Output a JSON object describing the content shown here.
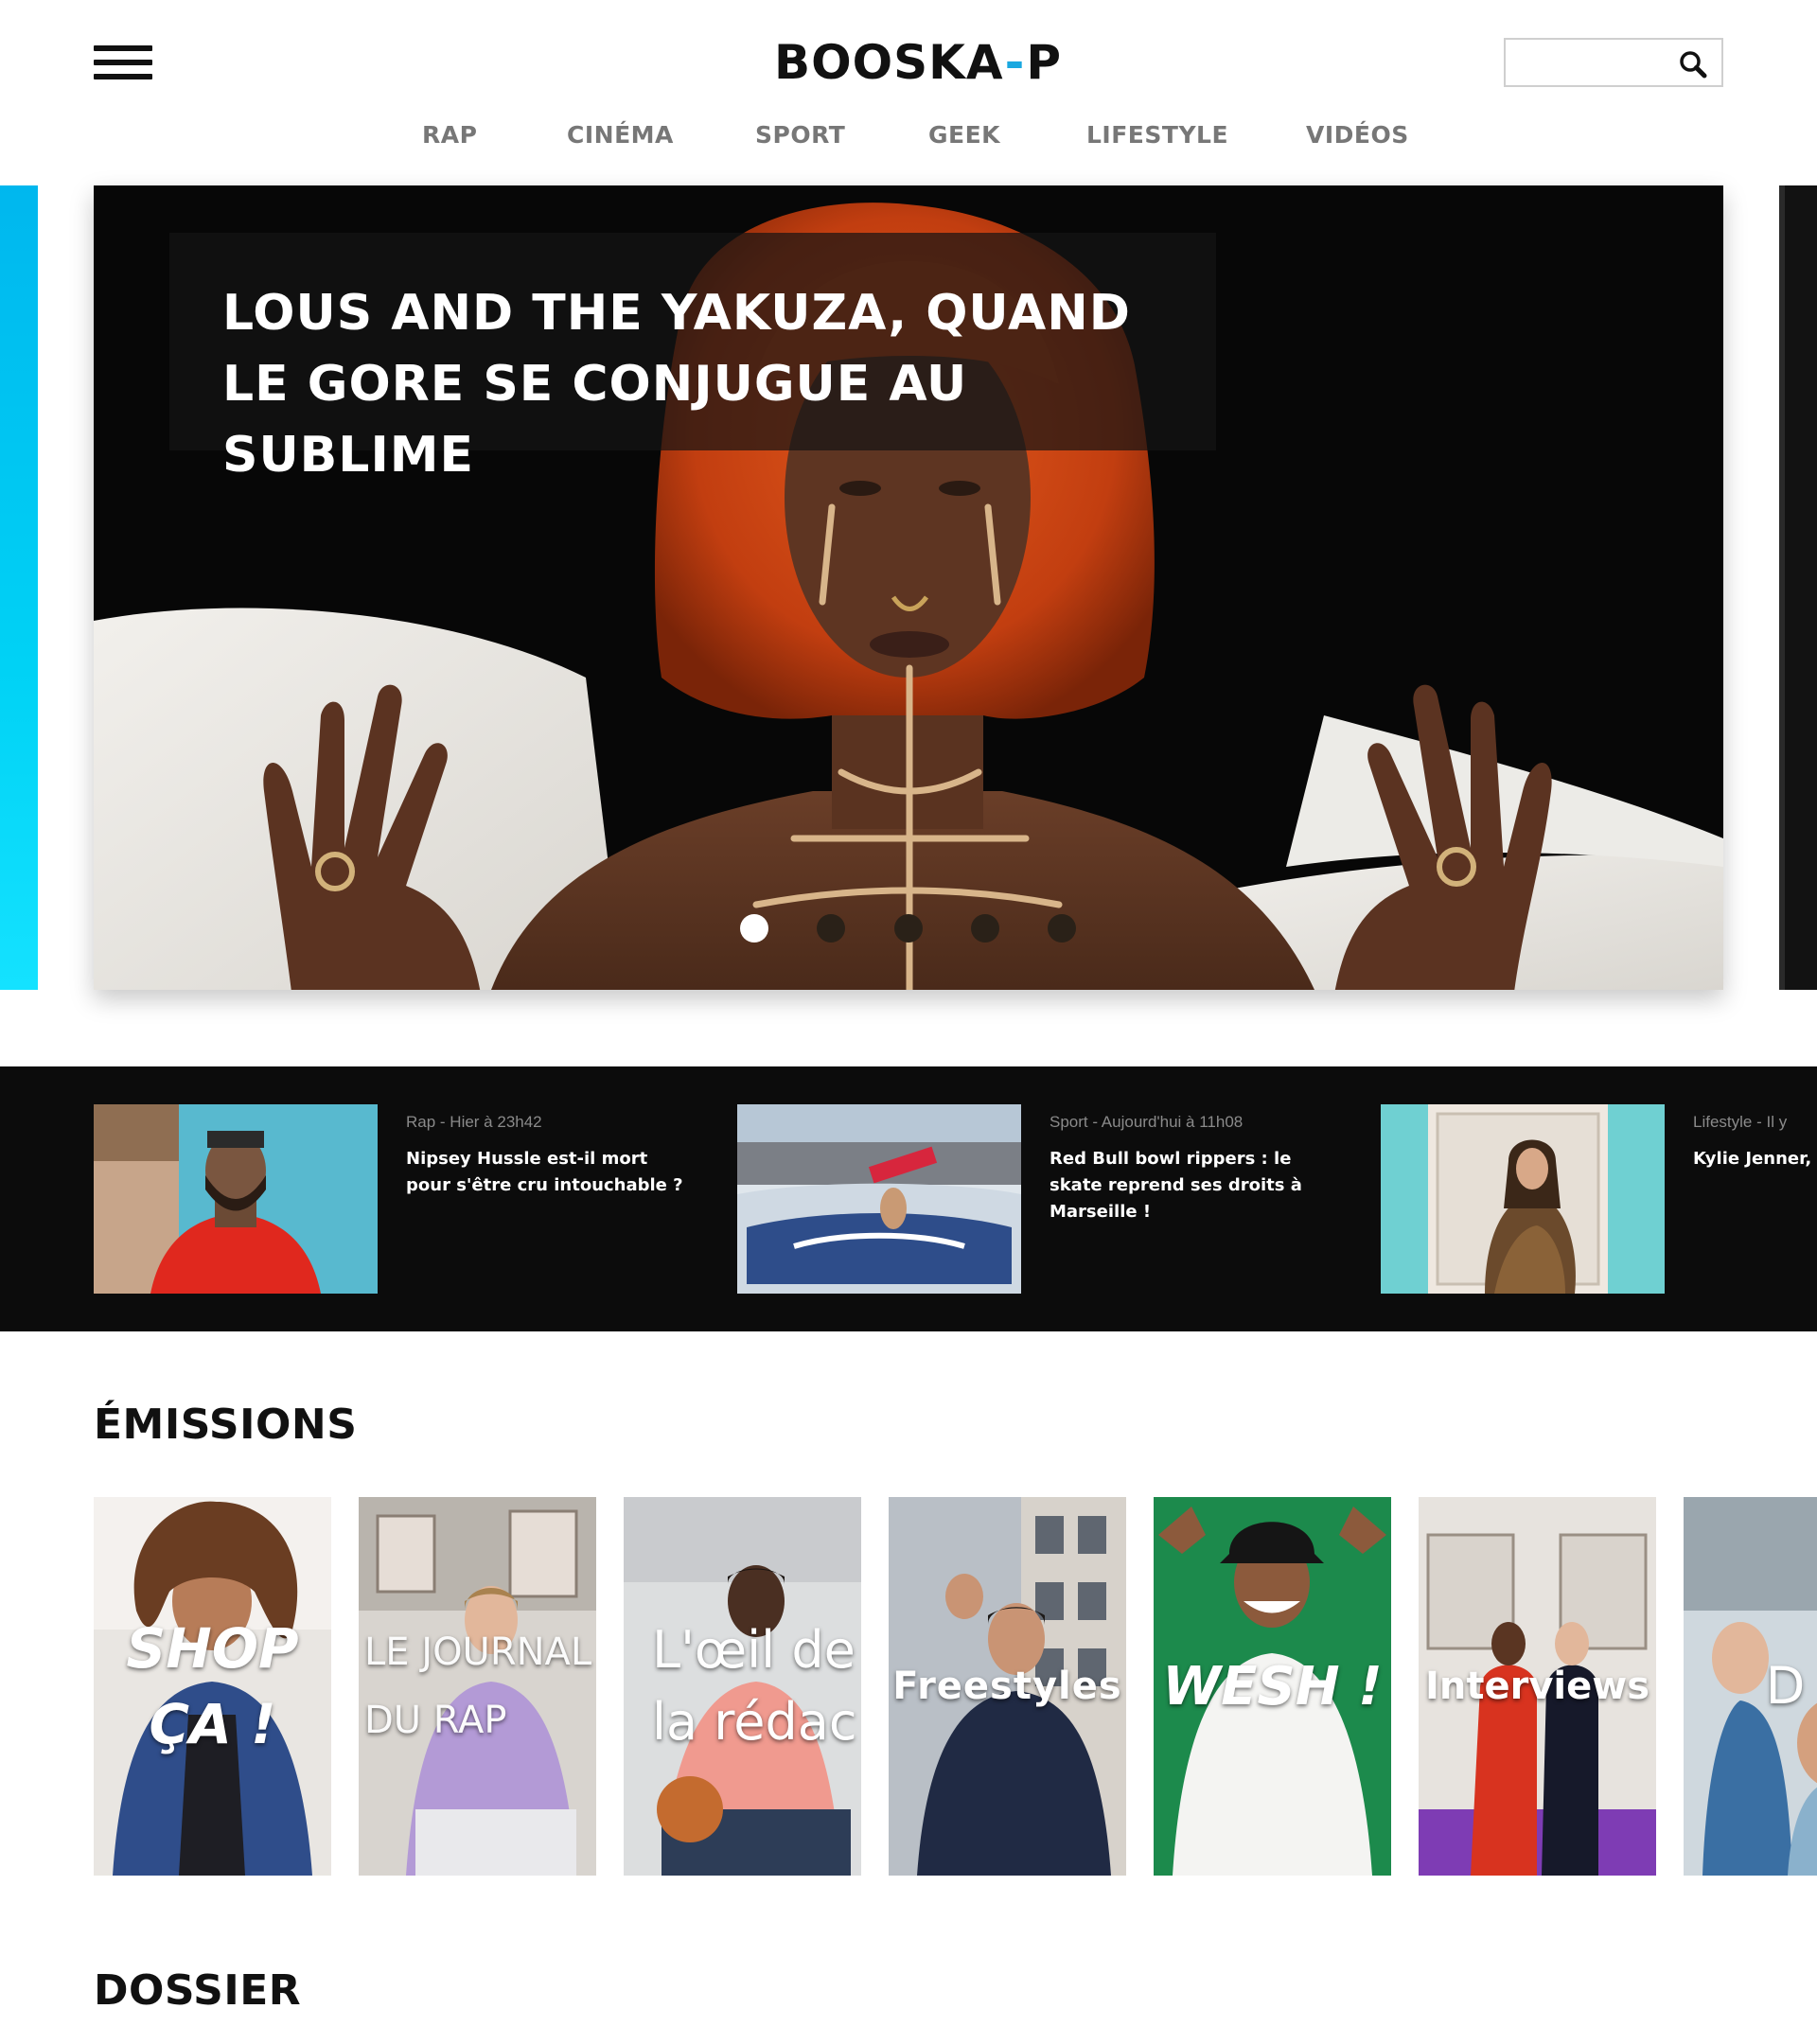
{
  "header": {
    "menu_icon": "hamburger-menu-icon",
    "logo": {
      "part1": "BOOSKA",
      "dash": "-",
      "part2": "P"
    },
    "search": {
      "placeholder": "",
      "icon": "search-icon"
    }
  },
  "nav": {
    "items": [
      {
        "label": "RAP"
      },
      {
        "label": "CINÉMA"
      },
      {
        "label": "SPORT"
      },
      {
        "label": "GEEK"
      },
      {
        "label": "LIFESTYLE"
      },
      {
        "label": "VIDÉOS"
      }
    ]
  },
  "hero": {
    "title": "LOUS AND THE YAKUZA, QUAND LE GORE SE CONJUGUE AU SUBLIME",
    "slide_count": 5,
    "active_slide": 1
  },
  "latest": [
    {
      "meta": "Rap - Hier à 23h42",
      "title": "Nipsey Hussle est-il mort pour s'être cru intouchable ?"
    },
    {
      "meta": "Sport - Aujourd'hui à 11h08",
      "title": "Red Bull bowl rippers : le skate reprend ses droits à Marseille !"
    },
    {
      "meta": "Lifestyle - Il y",
      "title": "Kylie Jenner, c mieux payée c"
    }
  ],
  "emissions": {
    "heading": "ÉMISSIONS",
    "shows": [
      {
        "label": "SHOP ÇA !"
      },
      {
        "label": "LE JOURNAL DU RAP"
      },
      {
        "label": "L'œil de la rédac"
      },
      {
        "label": "Freestyles"
      },
      {
        "label": "WESH !"
      },
      {
        "label": "Interviews"
      },
      {
        "label": "D la g"
      }
    ]
  },
  "dossier": {
    "heading": "DOSSIER"
  },
  "colors": {
    "accent": "#1aa8e0",
    "strip_bg": "#0c0c0c",
    "nav_text": "#777777"
  }
}
